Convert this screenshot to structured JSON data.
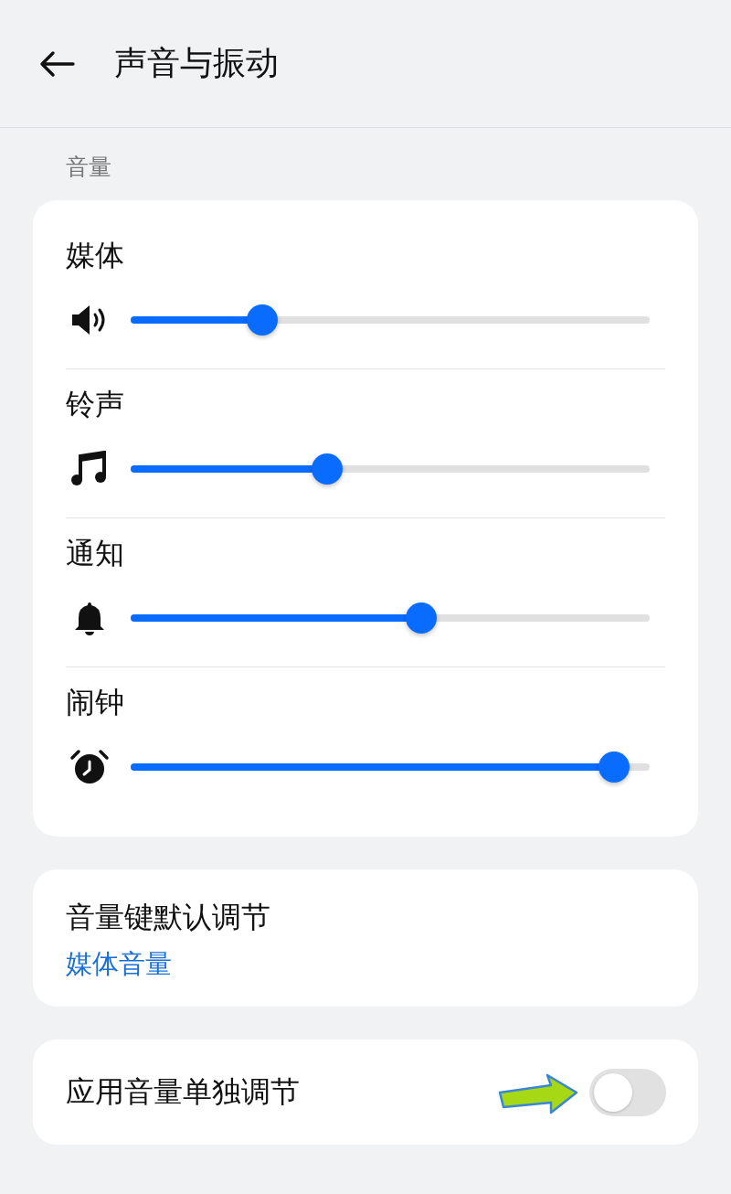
{
  "header": {
    "title": "声音与振动"
  },
  "section_label": "音量",
  "volume_sliders": [
    {
      "label": "媒体",
      "level": 0.254
    },
    {
      "label": "铃声",
      "level": 0.379
    },
    {
      "label": "通知",
      "level": 0.56
    },
    {
      "label": "闹钟",
      "level": 0.931
    }
  ],
  "volume_key": {
    "title": "音量键默认调节",
    "value": "媒体音量"
  },
  "app_volume": {
    "label": "应用音量单独调节",
    "on": false
  }
}
